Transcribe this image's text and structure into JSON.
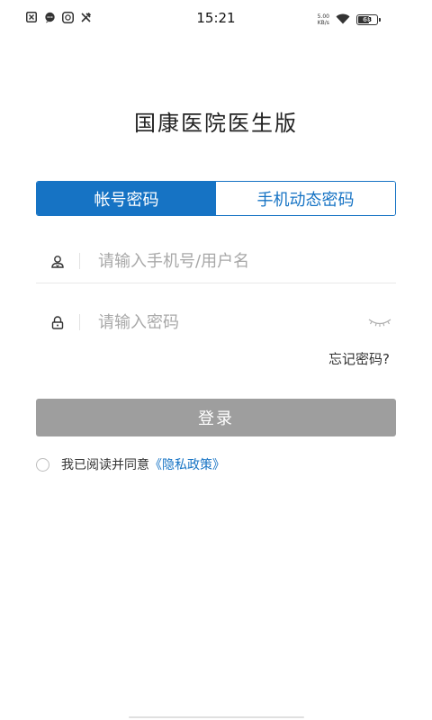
{
  "status_bar": {
    "time": "15:21",
    "net_speed_value": "5.00",
    "net_speed_unit": "KB/s",
    "battery_level": "68",
    "battery_fraction": 0.68,
    "left_icons": [
      "missed-call-icon",
      "message-icon",
      "chat-icon",
      "tools-icon"
    ]
  },
  "app": {
    "title": "国康医院医生版"
  },
  "tabs": [
    {
      "label": "帐号密码",
      "active": true
    },
    {
      "label": "手机动态密码",
      "active": false
    }
  ],
  "form": {
    "username_placeholder": "请输入手机号/用户名",
    "username_value": "",
    "password_placeholder": "请输入密码",
    "password_value": "",
    "forgot_label": "忘记密码?",
    "login_label": "登录",
    "agree_text": "我已阅读并同意",
    "privacy_link": "《隐私政策》",
    "agree_checked": false
  },
  "colors": {
    "accent": "#1673c4",
    "disabled_button": "#9e9e9e",
    "placeholder": "#a8a8a8"
  }
}
